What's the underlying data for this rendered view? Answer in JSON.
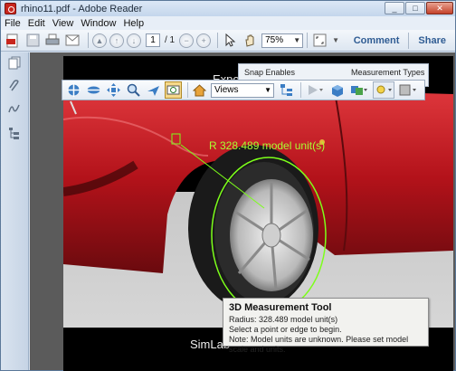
{
  "window": {
    "title": "rhino11.pdf - Adobe Reader",
    "buttons": {
      "minimize": "_",
      "maximize": "□",
      "close": "✕"
    }
  },
  "menu": [
    "File",
    "Edit",
    "View",
    "Window",
    "Help"
  ],
  "toolbar": {
    "page_current": "1",
    "page_total": "/ 1",
    "zoom": "75%",
    "comment_label": "Comment",
    "share_label": "Share"
  },
  "doc": {
    "exported_text": "Exported fro",
    "footer_text": "SimLab",
    "measurement_label": "R 328.489 model unit(s)"
  },
  "toolbar3d": {
    "views_label": "Views"
  },
  "panel": {
    "snap_label": "Snap Enables",
    "types_label": "Measurement Types"
  },
  "tooltip": {
    "title": "3D Measurement Tool",
    "line1": "Radius: 328.489 model unit(s)",
    "line2": "Select a point or edge to begin.",
    "line3": "Note: Model units are unknown.  Please set model scale and units."
  },
  "colors": {
    "car_red": "#c41a20",
    "measure_green": "#7dff1a",
    "link_blue": "#2f5c93"
  }
}
